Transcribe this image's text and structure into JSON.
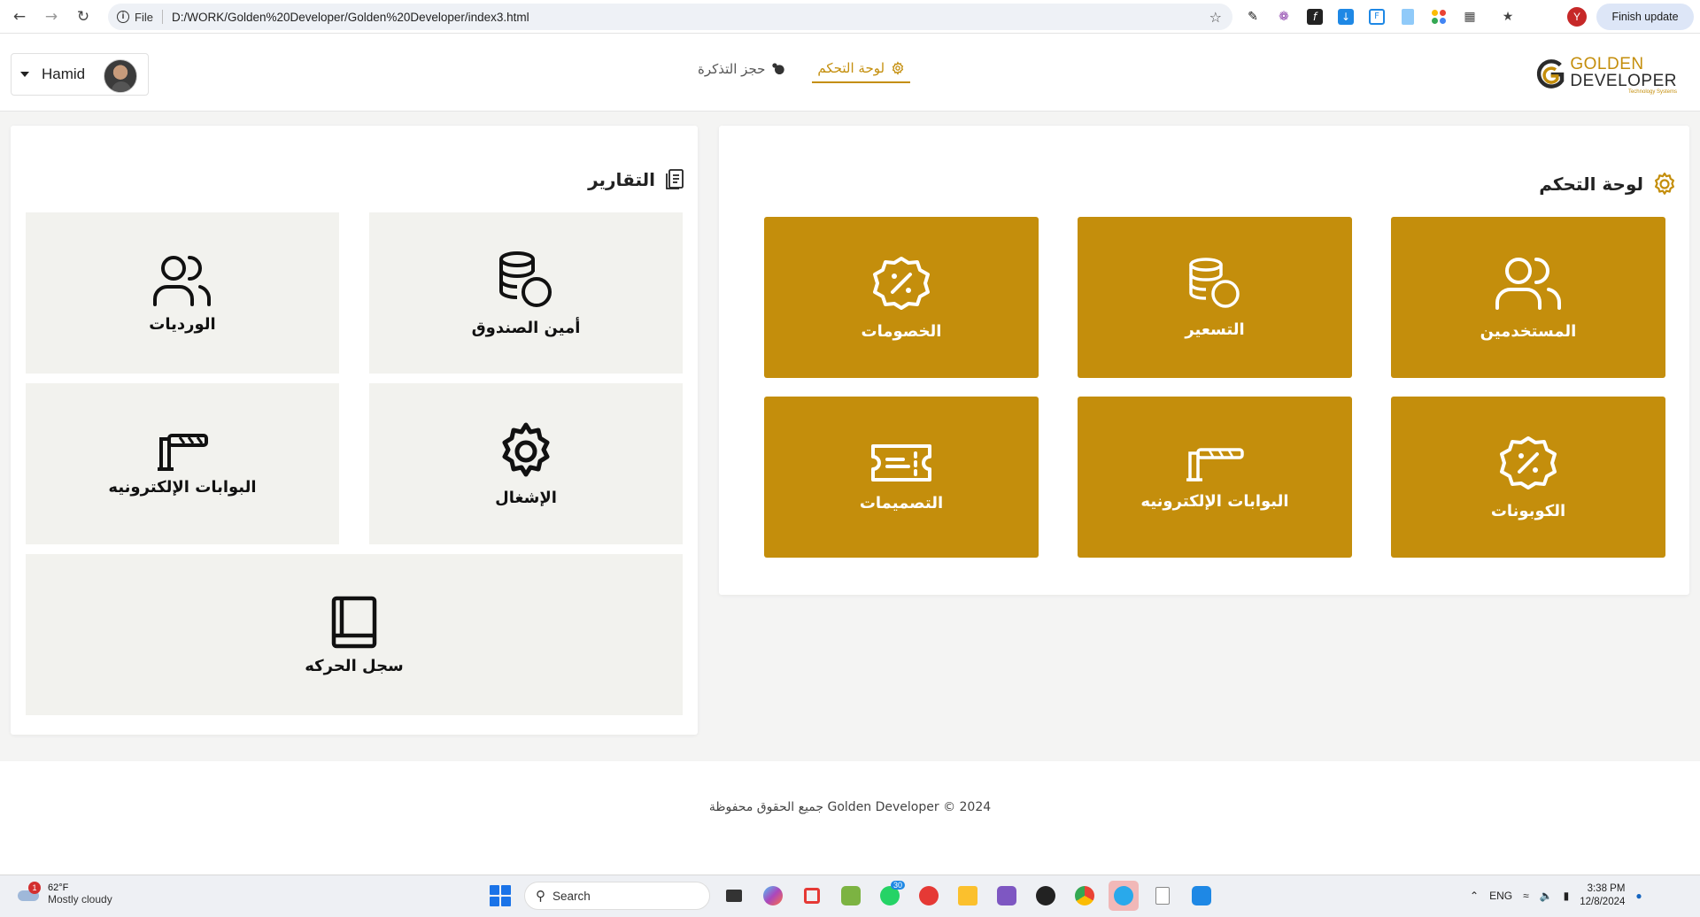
{
  "browser": {
    "info_label": "File",
    "url": "D:/WORK/Golden%20Developer/Golden%20Developer/index3.html",
    "profile_initial": "Y",
    "finish_update_label": "Finish update"
  },
  "header": {
    "user_name": "Hamid",
    "nav": [
      {
        "label": "لوحة التحكم",
        "active": true,
        "icon": "gear-icon"
      },
      {
        "label": "حجز التذكرة",
        "active": false,
        "icon": "ticket-icon"
      }
    ],
    "logo": {
      "line1": "GOLDEN",
      "line2": "DEVELOPER",
      "line3": "Technology Systems"
    }
  },
  "reports": {
    "title": "التقارير",
    "tiles": [
      {
        "label": "أمين الصندوق",
        "icon": "coins-icon"
      },
      {
        "label": "الورديات",
        "icon": "users-icon"
      },
      {
        "label": "الإشغال",
        "icon": "gear-icon"
      },
      {
        "label": "البوابات الإلكترونيه",
        "icon": "barrier-gate-icon"
      },
      {
        "label": "سجل الحركه",
        "icon": "book-icon"
      }
    ]
  },
  "dashboard": {
    "title": "لوحة التحكم",
    "tiles": [
      {
        "label": "المستخدمين",
        "icon": "users-icon"
      },
      {
        "label": "التسعير",
        "icon": "coins-icon"
      },
      {
        "label": "الخصومات",
        "icon": "discount-badge-icon"
      },
      {
        "label": "الكوبونات",
        "icon": "discount-badge-icon"
      },
      {
        "label": "البوابات الإلكترونيه",
        "icon": "barrier-gate-icon"
      },
      {
        "label": "التصميمات",
        "icon": "ticket-icon"
      }
    ]
  },
  "footer": {
    "text": "جميع الحقوق محفوظة Golden Developer © 2024"
  },
  "taskbar": {
    "weather_temp": "62°F",
    "weather_desc": "Mostly cloudy",
    "weather_badge": "1",
    "search_label": "Search",
    "whatsapp_count": "30",
    "language": "ENG",
    "time": "3:38 PM",
    "date": "12/8/2024"
  },
  "colors": {
    "accent": "#c48e0c",
    "tile_bg": "#f2f2ee",
    "page_bg": "#f4f4f3"
  }
}
